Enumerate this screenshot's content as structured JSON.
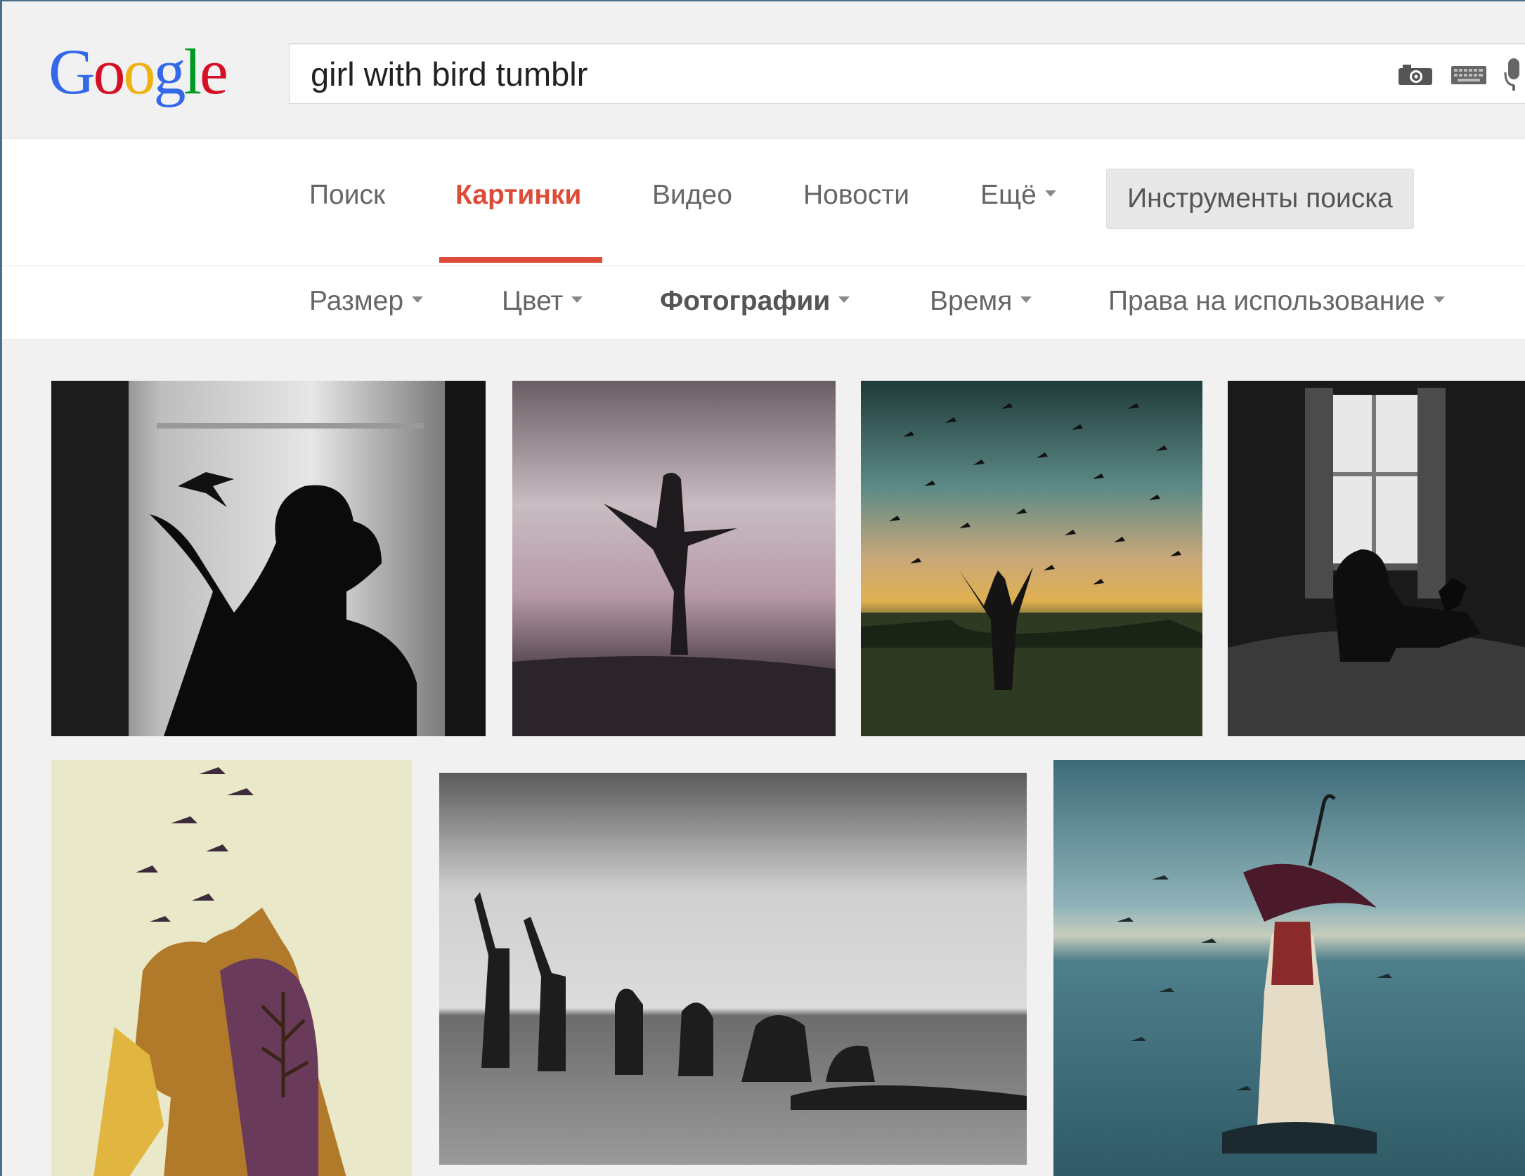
{
  "logo": {
    "letters": [
      "G",
      "o",
      "o",
      "g",
      "l",
      "e"
    ],
    "colors": [
      "#3369e8",
      "#d50f25",
      "#eeb211",
      "#3369e8",
      "#009925",
      "#d50f25"
    ]
  },
  "search": {
    "query": "girl with bird tumblr",
    "icons": [
      "camera-icon",
      "keyboard-icon",
      "microphone-icon"
    ]
  },
  "nav": {
    "tabs": [
      {
        "label": "Поиск",
        "active": false
      },
      {
        "label": "Картинки",
        "active": true
      },
      {
        "label": "Видео",
        "active": false
      },
      {
        "label": "Новости",
        "active": false
      },
      {
        "label": "Ещё",
        "active": false
      }
    ],
    "tools_label": "Инструменты поиска",
    "active_color": "#dd4b39"
  },
  "toolbar": {
    "items": [
      {
        "label": "Размер"
      },
      {
        "label": "Цвет"
      },
      {
        "label": "Фотографии"
      },
      {
        "label": "Время"
      },
      {
        "label": "Права на использование"
      }
    ]
  },
  "results": [
    {
      "subject": "girl-silhouette-hummingbird"
    },
    {
      "subject": "girl-arms-outstretched-sky"
    },
    {
      "subject": "girl-with-flock-of-birds"
    },
    {
      "subject": "girl-window-crow"
    },
    {
      "subject": "watercolor-girl-birds"
    },
    {
      "subject": "dancers-bowing-bw"
    },
    {
      "subject": "girl-umbrella-water"
    }
  ]
}
